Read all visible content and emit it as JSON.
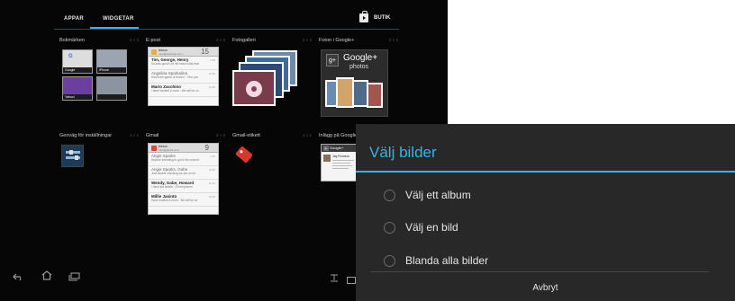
{
  "tabs": [
    {
      "label": "APPAR",
      "selected": false
    },
    {
      "label": "WIDGETAR",
      "selected": true
    }
  ],
  "store": {
    "label": "BUTIK",
    "icon": "shopping-bag-play-icon"
  },
  "widgets": [
    {
      "title": "Bokmärken",
      "size": "3 × 2"
    },
    {
      "title": "E-post",
      "size": "3 × 3"
    },
    {
      "title": "Fotogalleri",
      "size": "2 × 2"
    },
    {
      "title": "Foton i Google+",
      "size": "2 × 2"
    },
    {
      "title": "Genväg för inställningar",
      "size": "1 × 1"
    },
    {
      "title": "Gmail",
      "size": "3 × 3"
    },
    {
      "title": "Gmail-etikett",
      "size": "1 × 1"
    },
    {
      "title": "Inlägg på Google+",
      "size": "2 × 3"
    }
  ],
  "bookmarks": [
    {
      "label": "Google"
    },
    {
      "label": "iPhone"
    },
    {
      "label": "Yahoo!"
    },
    {
      "label": ""
    }
  ],
  "email_preview": {
    "header": "Inbox",
    "account": "user@example.com",
    "count": "15",
    "messages": [
      {
        "from": "Tim, George, Henry",
        "snippet": "Sounds good! Let me know what time",
        "time": "1:48"
      },
      {
        "from": "Angelina Sparkalina",
        "snippet": "How's the game of tennis? - See you",
        "time": "12:20"
      },
      {
        "from": "Mario Zacchino",
        "snippet": "I have booked a room - We will be on",
        "time": "11:50"
      }
    ]
  },
  "gmail_preview": {
    "header": "Inbox",
    "account": "user@gmail.com",
    "count": "9",
    "messages": [
      {
        "from": "Angie Sparks",
        "snippet": "Anyone intending to go to the concert",
        "time": "1:30"
      },
      {
        "from": "Angie Sparks, Gabe",
        "snippet": "Just double checking we are on for",
        "time": "12:25"
      },
      {
        "from": "Wendy, Gabe, Howard",
        "snippet": "I have the tickets - I'll bring them",
        "time": "11:10"
      },
      {
        "from": "Millie Jasinto",
        "snippet": "Have booked a room - We will be on",
        "time": "10:02"
      }
    ]
  },
  "gplus_photos": {
    "brand": "Google+",
    "sub": "photos",
    "badge": "g+"
  },
  "gplus_posts": {
    "header": "Google+",
    "author": "Jay Romero",
    "badge": "g+"
  },
  "dialog": {
    "title": "Välj bilder",
    "options": [
      {
        "label": "Välj ett album",
        "selected": false
      },
      {
        "label": "Välj en bild",
        "selected": false
      },
      {
        "label": "Blanda alla bilder",
        "selected": false
      }
    ],
    "cancel_label": "Avbryt"
  },
  "navbar": {
    "icons": [
      "back-icon",
      "home-icon",
      "recent-apps-icon"
    ]
  },
  "colors": {
    "accent": "#33b5e5",
    "screen_bg": "#060606",
    "dialog_bg": "#282828"
  }
}
